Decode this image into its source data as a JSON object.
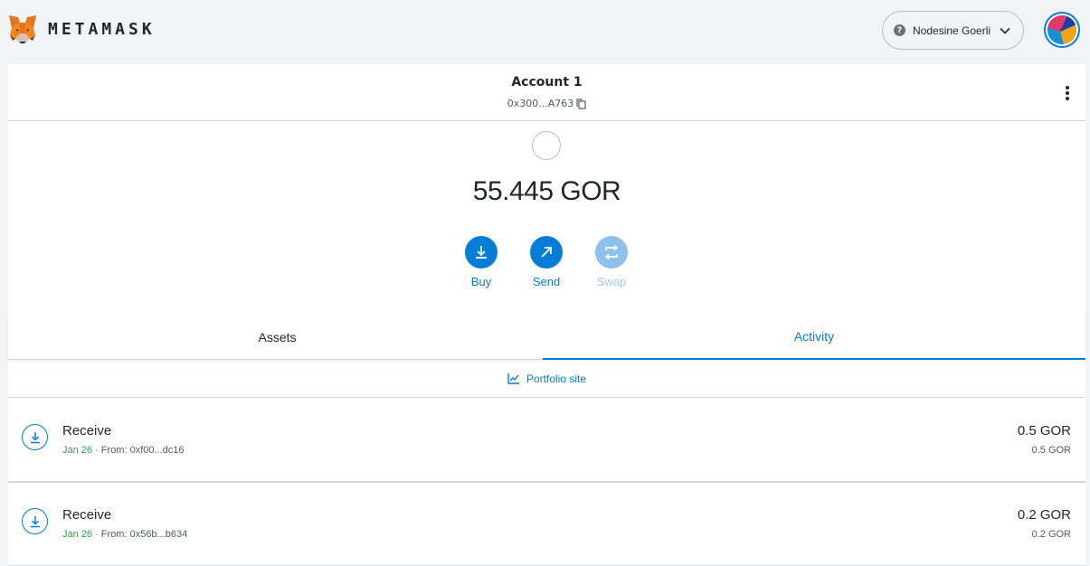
{
  "header": {
    "brand": "METAMASK",
    "network": {
      "label": "Nodesine Goerli",
      "badge": "?"
    }
  },
  "account": {
    "name": "Account 1",
    "address": "0x300...A763"
  },
  "balance": "55.445 GOR",
  "actions": [
    {
      "label": "Buy",
      "icon": "download-arrow-icon",
      "enabled": true
    },
    {
      "label": "Send",
      "icon": "diagonal-arrow-icon",
      "enabled": true
    },
    {
      "label": "Swap",
      "icon": "swap-icon",
      "enabled": false
    }
  ],
  "tabs": {
    "assets": "Assets",
    "activity": "Activity",
    "active": "activity"
  },
  "portfolio_link": "Portfolio site",
  "transactions": [
    {
      "title": "Receive",
      "date": "Jan 26",
      "from": " · From: 0xf00...dc16",
      "amount": "0.5 GOR",
      "fiat": "0.5 GOR"
    },
    {
      "title": "Receive",
      "date": "Jan 26",
      "from": " · From: 0x56b...b634",
      "amount": "0.2 GOR",
      "fiat": "0.2 GOR"
    }
  ],
  "colors": {
    "accent": "#037dd6",
    "success": "#28a745",
    "background": "#f2f3f4"
  }
}
